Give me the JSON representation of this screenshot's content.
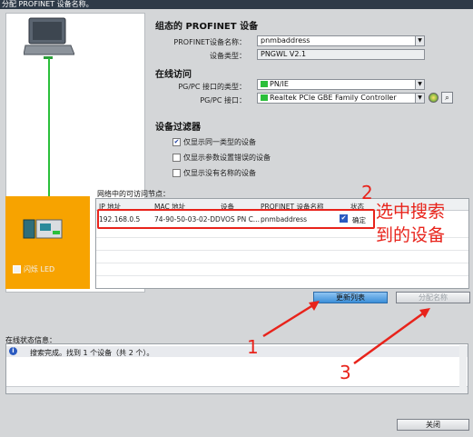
{
  "window": {
    "title": "分配 PROFINET 设备名称。"
  },
  "config": {
    "heading": "组态的 PROFINET 设备",
    "device_name_label": "PROFINET设备名称：",
    "device_name_value": "pnmbaddress",
    "device_type_label": "设备类型：",
    "device_type_value": "PNGWL V2.1"
  },
  "online": {
    "heading": "在线访问",
    "pgpc_type_label": "PG/PC 接口的类型：",
    "pgpc_type_value": "PN/IE",
    "pgpc_iface_label": "PG/PC 接口：",
    "pgpc_iface_value": "Realtek PCIe GBE Family Controller"
  },
  "filter": {
    "heading": "设备过滤器",
    "options": [
      {
        "label": "仅显示同一类型的设备",
        "checked": "✔"
      },
      {
        "label": "仅显示参数设置错误的设备",
        "checked": ""
      },
      {
        "label": "仅显示没有名称的设备",
        "checked": ""
      }
    ]
  },
  "table": {
    "caption": "网络中的可访问节点：",
    "headers": [
      "IP 地址",
      "MAC 地址",
      "设备",
      "PROFINET 设备名称",
      "状态"
    ],
    "rows": [
      {
        "ip": "192.168.0.5",
        "mac": "74-90-50-03-02-DD",
        "device": "VOS PN C...",
        "name": "pnmbaddress",
        "status": "确定"
      }
    ]
  },
  "buttons": {
    "refresh": "更新列表",
    "assign": "分配名称",
    "close": "关闭"
  },
  "left": {
    "flash_led": "闪烁 LED"
  },
  "status": {
    "label": "在线状态信息：",
    "message": "搜索完成。找到 1 个设备（共 2 个）。"
  },
  "annotations": {
    "n1": "1",
    "n2": "2",
    "n3": "3",
    "callout": "选中搜索\n到的设备"
  },
  "colors": {
    "highlight_red": "#e8231b",
    "accent_orange": "#f7a300",
    "button_blue": "#3b8fd8",
    "link_green": "#2bbf3a"
  }
}
